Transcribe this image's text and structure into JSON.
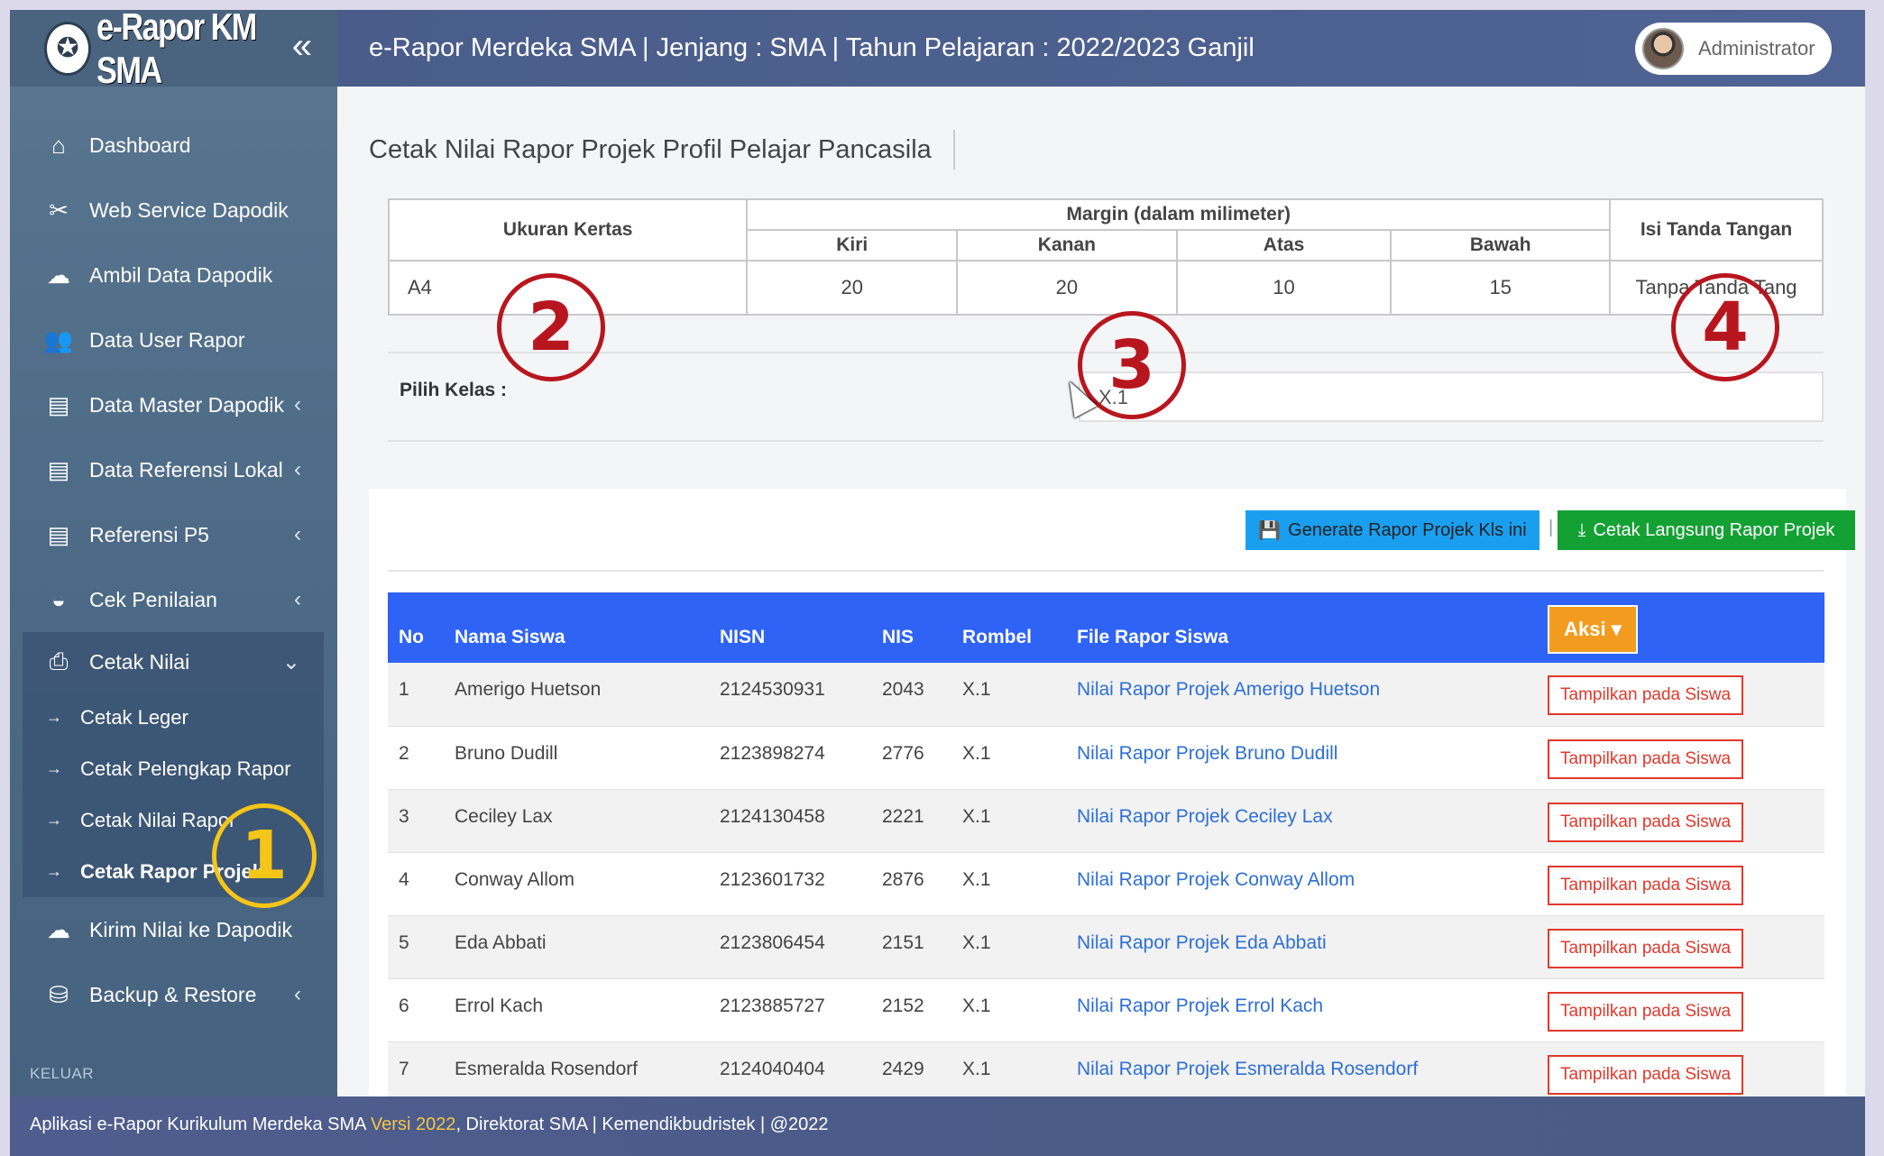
{
  "brand": {
    "logo_glyph": "✪",
    "name": "e-Rapor KM SMA",
    "collapse_glyph": "«"
  },
  "header": {
    "title": "e-Rapor Merdeka SMA | Jenjang : SMA | Tahun Pelajaran : 2022/2023 Ganjil",
    "user": "Administrator"
  },
  "sidebar": {
    "items": [
      {
        "label": "Dashboard",
        "icon": "⌂",
        "icon_name": "home-icon",
        "chevron": ""
      },
      {
        "label": "Web Service Dapodik",
        "icon": "✂",
        "icon_name": "tools-icon",
        "chevron": ""
      },
      {
        "label": "Ambil Data Dapodik",
        "icon": "☁",
        "icon_name": "cloud-download-icon",
        "chevron": ""
      },
      {
        "label": "Data User Rapor",
        "icon": "👥",
        "icon_name": "users-icon",
        "chevron": ""
      },
      {
        "label": "Data Master Dapodik",
        "icon": "▤",
        "icon_name": "database-icon",
        "chevron": "‹"
      },
      {
        "label": "Data Referensi Lokal",
        "icon": "▤",
        "icon_name": "archive-icon",
        "chevron": "‹"
      },
      {
        "label": "Referensi P5",
        "icon": "▤",
        "icon_name": "archive-icon",
        "chevron": "‹"
      },
      {
        "label": "Cek Penilaian",
        "icon": "◒",
        "icon_name": "dashboard-gauge-icon",
        "chevron": "‹"
      }
    ],
    "cetak_nilai": {
      "label": "Cetak Nilai",
      "icon": "⎙",
      "chevron": "⌄",
      "sub": [
        {
          "label": "Cetak Leger",
          "arrow": "→"
        },
        {
          "label": "Cetak Pelengkap Rapor",
          "arrow": "→"
        },
        {
          "label": "Cetak Nilai Rapor",
          "arrow": "→"
        },
        {
          "label": "Cetak Rapor Projek",
          "arrow": "→"
        }
      ]
    },
    "bottom_items": [
      {
        "label": "Kirim Nilai ke Dapodik",
        "icon": "☁",
        "chevron": ""
      },
      {
        "label": "Backup & Restore",
        "icon": "⛁",
        "chevron": "‹"
      }
    ],
    "keluar": "KELUAR"
  },
  "page": {
    "title": "Cetak Nilai Rapor Projek Profil Pelajar Pancasila"
  },
  "settings": {
    "headers": {
      "ukuran_kertas": "Ukuran Kertas",
      "margin": "Margin (dalam milimeter)",
      "kiri": "Kiri",
      "kanan": "Kanan",
      "atas": "Atas",
      "bawah": "Bawah",
      "ttd": "Isi Tanda Tangan"
    },
    "values": {
      "ukuran_kertas": "A4",
      "kiri": "20",
      "kanan": "20",
      "atas": "10",
      "bawah": "15",
      "ttd": "Tanpa Tanda Tang"
    }
  },
  "pilih_kelas": {
    "label": "Pilih Kelas :",
    "value": "X.1"
  },
  "buttons": {
    "generate": "Generate Rapor Projek Kls ini",
    "generate_icon": "💾",
    "separator": "|",
    "cetak": "Cetak Langsung Rapor Projek",
    "cetak_icon": "⤓"
  },
  "table": {
    "columns": [
      "No",
      "Nama Siswa",
      "NISN",
      "NIS",
      "Rombel",
      "File Rapor Siswa"
    ],
    "aksi": "Aksi ▾",
    "tampil_label": "Tampilkan pada Siswa",
    "rows": [
      {
        "no": "1",
        "nama": "Amerigo Huetson",
        "nisn": "2124530931",
        "nis": "2043",
        "rombel": "X.1",
        "file": "Nilai Rapor Projek Amerigo Huetson"
      },
      {
        "no": "2",
        "nama": "Bruno Dudill",
        "nisn": "2123898274",
        "nis": "2776",
        "rombel": "X.1",
        "file": "Nilai Rapor Projek Bruno Dudill"
      },
      {
        "no": "3",
        "nama": "Ceciley Lax",
        "nisn": "2124130458",
        "nis": "2221",
        "rombel": "X.1",
        "file": "Nilai Rapor Projek Ceciley Lax"
      },
      {
        "no": "4",
        "nama": "Conway Allom",
        "nisn": "2123601732",
        "nis": "2876",
        "rombel": "X.1",
        "file": "Nilai Rapor Projek Conway Allom"
      },
      {
        "no": "5",
        "nama": "Eda Abbati",
        "nisn": "2123806454",
        "nis": "2151",
        "rombel": "X.1",
        "file": "Nilai Rapor Projek Eda Abbati"
      },
      {
        "no": "6",
        "nama": "Errol Kach",
        "nisn": "2123885727",
        "nis": "2152",
        "rombel": "X.1",
        "file": "Nilai Rapor Projek Errol Kach"
      },
      {
        "no": "7",
        "nama": "Esmeralda Rosendorf",
        "nisn": "2124040404",
        "nis": "2429",
        "rombel": "X.1",
        "file": "Nilai Rapor Projek Esmeralda Rosendorf"
      }
    ]
  },
  "footer": {
    "prefix": "Aplikasi e-Rapor Kurikulum Merdeka SMA ",
    "version": "Versi 2022",
    "suffix": ", Direktorat SMA | Kemendikbudristek | @2022"
  },
  "annotations": {
    "m1": "1",
    "m2": "2",
    "m3": "3",
    "m4": "4"
  },
  "colors": {
    "header": "#4a5d8a",
    "sidebar": "#4d6a86",
    "table_head": "#2e63f5",
    "generate": "#1a9ff0",
    "cetak": "#14a134",
    "tampil": "#e0392c",
    "aksi": "#f29c1f",
    "marker_red": "#b8161e",
    "marker_yellow": "#f5c518"
  }
}
